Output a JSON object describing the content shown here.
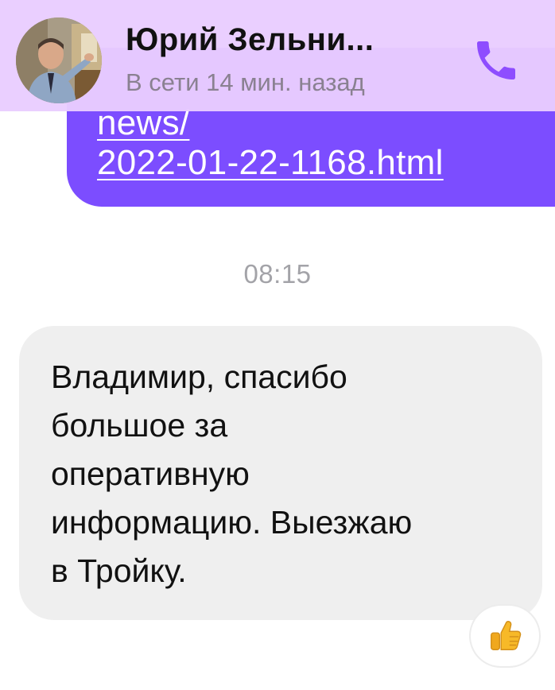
{
  "header": {
    "contact_name": "Юрий Зельни...",
    "status": "В сети 14 мин. назад",
    "call_icon": "phone-icon",
    "accent_color": "#7c4dff",
    "background_color": "#e9cdff"
  },
  "messages": {
    "outgoing": {
      "link_line_1": "news/",
      "link_line_2": "2022-01-22-1168.html",
      "bubble_color": "#7c4dff"
    },
    "timestamp": "08:15",
    "incoming": {
      "lines": [
        "Владимир, спасибо",
        "большое за",
        "оперативную",
        "информацию. Выезжаю",
        "в Тройку."
      ],
      "bubble_color": "#efefef",
      "reaction_icon": "thumbs-up-icon"
    }
  }
}
